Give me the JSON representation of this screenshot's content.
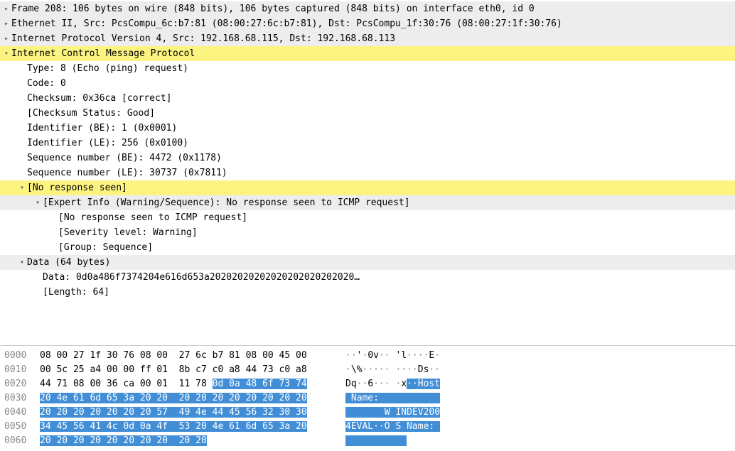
{
  "tree": {
    "frame": "Frame 208: 106 bytes on wire (848 bits), 106 bytes captured (848 bits) on interface eth0, id 0",
    "eth": "Ethernet II, Src: PcsCompu_6c:b7:81 (08:00:27:6c:b7:81), Dst: PcsCompu_1f:30:76 (08:00:27:1f:30:76)",
    "ip": "Internet Protocol Version 4, Src: 192.168.68.115, Dst: 192.168.68.113",
    "icmp": "Internet Control Message Protocol",
    "icmp_fields": {
      "type": "Type: 8 (Echo (ping) request)",
      "code": "Code: 0",
      "checksum": "Checksum: 0x36ca [correct]",
      "checksum_status": "[Checksum Status: Good]",
      "id_be": "Identifier (BE): 1 (0x0001)",
      "id_le": "Identifier (LE): 256 (0x0100)",
      "seq_be": "Sequence number (BE): 4472 (0x1178)",
      "seq_le": "Sequence number (LE): 30737 (0x7811)",
      "no_resp": "[No response seen]",
      "expert": "[Expert Info (Warning/Sequence): No response seen to ICMP request]",
      "expert_sub1": "[No response seen to ICMP request]",
      "expert_sub2": "[Severity level: Warning]",
      "expert_sub3": "[Group: Sequence]"
    },
    "data_hdr": "Data (64 bytes)",
    "data_value": "Data: 0d0a486f7374204e616d653a20202020202020202020202020…",
    "data_len": "[Length: 64]"
  },
  "hex": {
    "rows": [
      {
        "offset": "0000",
        "bytes": [
          {
            "t": "08 00 27 1f 30 76 08 00  27 6c b7 81 08 00 45 00",
            "sel": false
          }
        ],
        "ascii": [
          {
            "t": "··",
            "sel": false,
            "v": false
          },
          {
            "t": "'",
            "sel": false,
            "v": true
          },
          {
            "t": "·",
            "sel": false,
            "v": false
          },
          {
            "t": "0v",
            "sel": false,
            "v": true
          },
          {
            "t": "·· ",
            "sel": false,
            "v": false
          },
          {
            "t": "'l",
            "sel": false,
            "v": true
          },
          {
            "t": "····",
            "sel": false,
            "v": false
          },
          {
            "t": "E",
            "sel": false,
            "v": true
          },
          {
            "t": "·",
            "sel": false,
            "v": false
          }
        ]
      },
      {
        "offset": "0010",
        "bytes": [
          {
            "t": "00 5c 25 a4 00 00 ff 01  8b c7 c0 a8 44 73 c0 a8",
            "sel": false
          }
        ],
        "ascii": [
          {
            "t": "·",
            "sel": false,
            "v": false
          },
          {
            "t": "\\%",
            "sel": false,
            "v": true
          },
          {
            "t": "····· ····",
            "sel": false,
            "v": false
          },
          {
            "t": "Ds",
            "sel": false,
            "v": true
          },
          {
            "t": "··",
            "sel": false,
            "v": false
          }
        ]
      },
      {
        "offset": "0020",
        "bytes": [
          {
            "t": "44 71 08 00 36 ca 00 01  11 78 ",
            "sel": false
          },
          {
            "t": "0d 0a 48 6f 73 74",
            "sel": true
          }
        ],
        "ascii": [
          {
            "t": "Dq",
            "sel": false,
            "v": true
          },
          {
            "t": "··",
            "sel": false,
            "v": false
          },
          {
            "t": "6",
            "sel": false,
            "v": true
          },
          {
            "t": "··· ·",
            "sel": false,
            "v": false
          },
          {
            "t": "x",
            "sel": false,
            "v": true
          },
          {
            "t": "··",
            "sel": true,
            "v": false
          },
          {
            "t": "Host",
            "sel": true,
            "v": true
          }
        ]
      },
      {
        "offset": "0030",
        "bytes": [
          {
            "t": "20 4e 61 6d 65 3a 20 20  20 20 20 20 20 20 20 20",
            "sel": true
          }
        ],
        "ascii": [
          {
            "t": " Name:           ",
            "sel": true,
            "v": true
          }
        ]
      },
      {
        "offset": "0040",
        "bytes": [
          {
            "t": "20 20 20 20 20 20 20 57  49 4e 44 45 56 32 30 30",
            "sel": true
          }
        ],
        "ascii": [
          {
            "t": "       W INDEV200",
            "sel": true,
            "v": true
          }
        ]
      },
      {
        "offset": "0050",
        "bytes": [
          {
            "t": "34 45 56 41 4c 0d 0a 4f  53 20 4e 61 6d 65 3a 20",
            "sel": true
          }
        ],
        "ascii": [
          {
            "t": "4EVAL",
            "sel": true,
            "v": true
          },
          {
            "t": "··",
            "sel": true,
            "v": false
          },
          {
            "t": "O S Name: ",
            "sel": true,
            "v": true
          }
        ]
      },
      {
        "offset": "0060",
        "bytes": [
          {
            "t": "20 20 20 20 20 20 20 20  20 20",
            "sel": true
          }
        ],
        "ascii": [
          {
            "t": "           ",
            "sel": true,
            "v": true
          }
        ]
      }
    ]
  }
}
